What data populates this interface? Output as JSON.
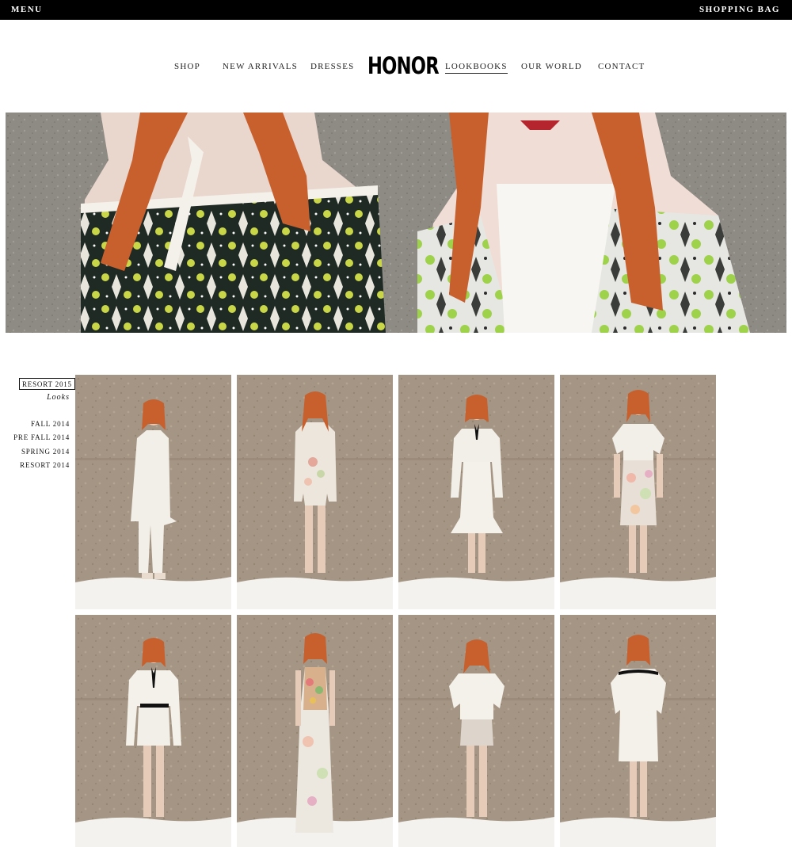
{
  "topbar": {
    "menu": "MENU",
    "bag": "SHOPPING BAG"
  },
  "nav": {
    "shop": "SHOP",
    "new_arrivals": "NEW ARRIVALS",
    "dresses": "DRESSES",
    "logo": "HONOR",
    "lookbooks": "LOOKBOOKS",
    "our_world": "OUR WORLD",
    "contact": "CONTACT"
  },
  "sidebar": {
    "current": "RESORT 2015",
    "looks": "Looks",
    "seasons": [
      "FALL 2014",
      "PRE FALL 2014",
      "SPRING 2014",
      "RESORT 2014"
    ]
  },
  "looks": [
    {
      "outfit": "white-coat-lace-pants"
    },
    {
      "outfit": "floral-top-shorts"
    },
    {
      "outfit": "cropped-jacket-flared-skirt"
    },
    {
      "outfit": "crop-top-floral-skirt"
    },
    {
      "outfit": "blouse-scalloped-shorts"
    },
    {
      "outfit": "embellished-halter-gown"
    },
    {
      "outfit": "lace-top-shorts"
    },
    {
      "outfit": "lace-shift-dress"
    }
  ],
  "colors": {
    "topbar": "#000000",
    "wall": "#a8988a",
    "hair": "#c8602e",
    "garment": "#f2efe8"
  }
}
